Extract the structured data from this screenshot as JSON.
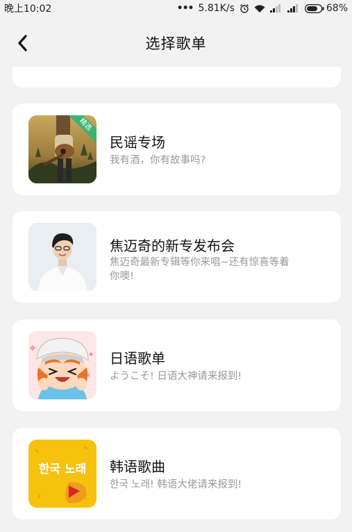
{
  "status": {
    "time": "晚上10:02",
    "network": "5.81K/s",
    "battery": "68%"
  },
  "nav": {
    "title": "选择歌单"
  },
  "playlists": [
    {
      "title": "民谣专场",
      "desc": "我有酒，你有故事吗?",
      "badge": "精选"
    },
    {
      "title": "焦迈奇的新专发布会",
      "desc": "焦迈奇最新专辑等你来唱~还有惊喜等着你噢!"
    },
    {
      "title": "日语歌单",
      "desc": "ようこそ! 日语大神请来报到!"
    },
    {
      "title": "韩语歌曲",
      "desc": "한국 노래! 韩语大佬请来报到!",
      "cover_text": "한국 노래"
    }
  ]
}
